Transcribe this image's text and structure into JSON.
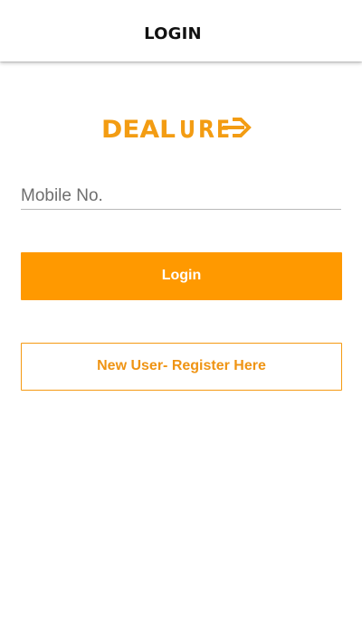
{
  "header": {
    "title": "LOGIN"
  },
  "logo": {
    "text_left": "DEAL",
    "text_u": "U",
    "text_r": "R",
    "text_e": "E",
    "icon": "arrow-right-icon"
  },
  "form": {
    "mobile_placeholder": "Mobile No.",
    "mobile_value": ""
  },
  "buttons": {
    "login_label": "Login",
    "register_label": "New User- Register Here"
  },
  "colors": {
    "brand_orange": "#ff9900",
    "border_orange": "#f59a12",
    "title_text": "#111111"
  }
}
